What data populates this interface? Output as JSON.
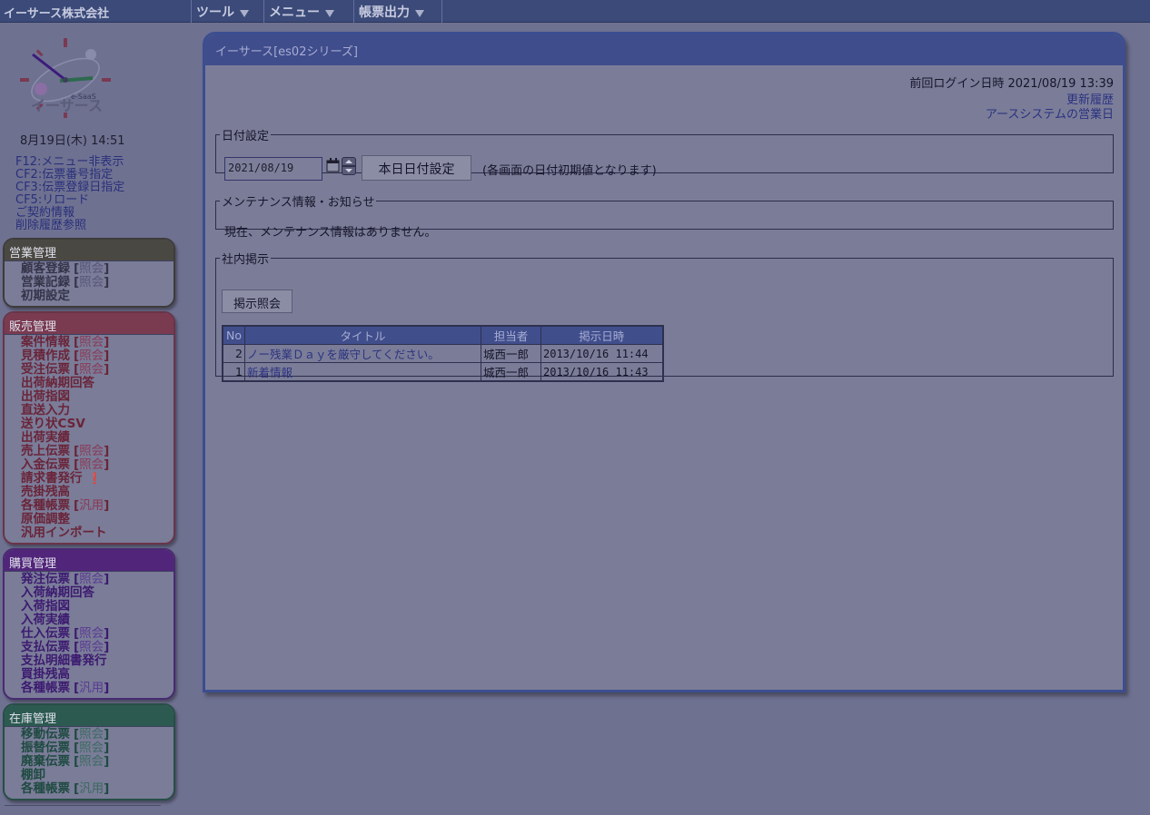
{
  "topbar": {
    "company": "イーサース株式会社",
    "menus": [
      "ツール",
      "メニュー",
      "帳票出力"
    ]
  },
  "clock": {
    "logo_text": "イーサース",
    "logo_sub": "e-SaaS",
    "datetime": "8月19日(木) 14:51"
  },
  "quick_links": [
    "F12:メニュー非表示",
    "CF2:伝票番号指定",
    "CF3:伝票登録日指定",
    "CF5:リロード",
    "ご契約情報",
    "削除履歴参照"
  ],
  "panels": {
    "sales": {
      "title": "営業管理",
      "items": [
        {
          "label": "顧客登録",
          "bracket": "照会"
        },
        {
          "label": "営業記録",
          "bracket": "照会"
        },
        {
          "label": "初期設定",
          "bracket": ""
        }
      ]
    },
    "hanbai": {
      "title": "販売管理",
      "items": [
        {
          "label": "案件情報",
          "bracket": "照会"
        },
        {
          "label": "見積作成",
          "bracket": "照会"
        },
        {
          "label": "受注伝票",
          "bracket": "照会"
        },
        {
          "label": "出荷納期回答",
          "bracket": ""
        },
        {
          "label": "出荷指図",
          "bracket": ""
        },
        {
          "label": "直送入力",
          "bracket": ""
        },
        {
          "label": "送り状CSV",
          "bracket": ""
        },
        {
          "label": "出荷実績",
          "bracket": ""
        },
        {
          "label": "売上伝票",
          "bracket": "照会"
        },
        {
          "label": "入金伝票",
          "bracket": "照会"
        },
        {
          "label": "請求書発行",
          "bracket": ""
        },
        {
          "label": "売掛残高",
          "bracket": ""
        },
        {
          "label": "各種帳票",
          "bracket": "汎用"
        },
        {
          "label": "原価調整",
          "bracket": ""
        },
        {
          "label": "汎用インポート",
          "bracket": ""
        }
      ]
    },
    "kobai": {
      "title": "購買管理",
      "items": [
        {
          "label": "発注伝票",
          "bracket": "照会"
        },
        {
          "label": "入荷納期回答",
          "bracket": ""
        },
        {
          "label": "入荷指図",
          "bracket": ""
        },
        {
          "label": "入荷実績",
          "bracket": ""
        },
        {
          "label": "仕入伝票",
          "bracket": "照会"
        },
        {
          "label": "支払伝票",
          "bracket": "照会"
        },
        {
          "label": "支払明細書発行",
          "bracket": ""
        },
        {
          "label": "買掛残高",
          "bracket": ""
        },
        {
          "label": "各種帳票",
          "bracket": "汎用"
        }
      ]
    },
    "zaiko": {
      "title": "在庫管理",
      "items": [
        {
          "label": "移動伝票",
          "bracket": "照会"
        },
        {
          "label": "振替伝票",
          "bracket": "照会"
        },
        {
          "label": "廃棄伝票",
          "bracket": "照会"
        },
        {
          "label": "棚卸",
          "bracket": ""
        },
        {
          "label": "各種帳票",
          "bracket": "汎用"
        }
      ]
    }
  },
  "main": {
    "title": "イーサース[es02シリーズ]",
    "last_login": "前回ログイン日時 2021/08/19 13:39",
    "link_history": "更新履歴",
    "link_business_day": "アースシステムの営業日",
    "date_setting": {
      "legend": "日付設定",
      "value": "2021/08/19",
      "button": "本日日付設定",
      "note": "(各画面の日付初期値となります)"
    },
    "maintenance": {
      "legend": "メンテナンス情報・お知らせ",
      "text": "現在、メンテナンス情報はありません。"
    },
    "board": {
      "legend": "社内掲示",
      "button": "掲示照会",
      "headers": [
        "No",
        "タイトル",
        "担当者",
        "掲示日時"
      ],
      "rows": [
        {
          "no": "2",
          "title": "ノー残業Ｄａｙを厳守してください。",
          "person": "城西一郎",
          "datetime": "2013/10/16 11:44"
        },
        {
          "no": "1",
          "title": "新着情報",
          "person": "城西一郎",
          "datetime": "2013/10/16 11:43"
        }
      ]
    }
  }
}
